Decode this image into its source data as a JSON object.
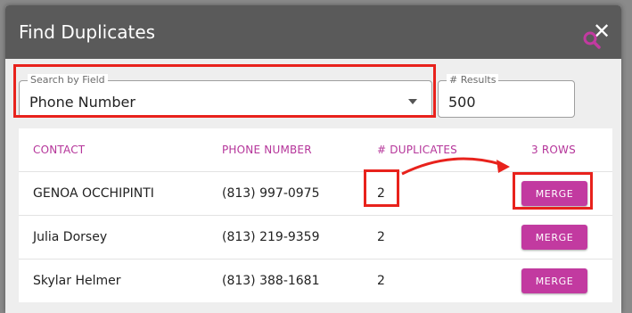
{
  "dialog": {
    "title": "Find Duplicates",
    "close_icon": "close-icon"
  },
  "search": {
    "field_label": "Search by Field",
    "field_value": "Phone Number",
    "results_label": "# Results",
    "results_value": "500"
  },
  "table": {
    "headers": [
      "CONTACT",
      "PHONE NUMBER",
      "# DUPLICATES",
      "3 ROWS"
    ],
    "rows": [
      {
        "contact": "GENOA OCCHIPINTI",
        "phone": "(813) 997-0975",
        "duplicates": "2",
        "action": "MERGE"
      },
      {
        "contact": "Julia Dorsey",
        "phone": "(813) 219-9359",
        "duplicates": "2",
        "action": "MERGE"
      },
      {
        "contact": "Skylar Helmer",
        "phone": "(813) 388-1681",
        "duplicates": "2",
        "action": "MERGE"
      }
    ]
  },
  "colors": {
    "accent": "#c23aa0",
    "highlight": "#e8221c",
    "header": "#5a5a5a"
  }
}
